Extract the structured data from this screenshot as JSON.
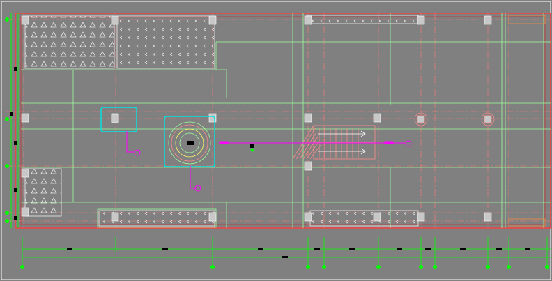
{
  "drawing": {
    "view": "CAD floor plan",
    "background": "#808080",
    "colors": {
      "wall": "#ff3b3b",
      "wall_dark": "#c83232",
      "axis": "#ff7a7a",
      "outline": "#9cff9c",
      "dimension": "#00ff00",
      "fixture": "#00e5e5",
      "pipe": "#ff00ff",
      "hatch": "#ffffff",
      "column": "#c8c8c8",
      "marker": "#000000",
      "stair": "#ff8a8a",
      "frame": "#ffffff"
    },
    "elements": {
      "hatch_panels": 6,
      "columns": 20,
      "stairs": 1,
      "fixtures": 2,
      "pipe_lines": 3,
      "dimension_ticks": 14
    }
  }
}
